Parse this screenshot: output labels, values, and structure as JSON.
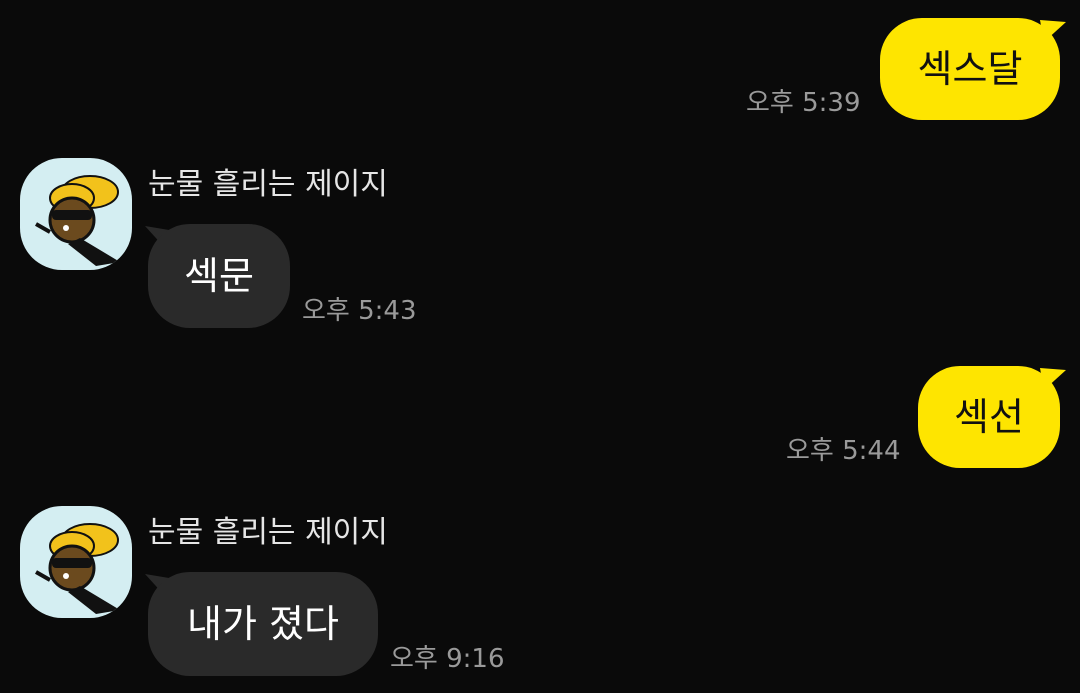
{
  "messages": [
    {
      "from": "me",
      "text": "섹스달",
      "time": "오후 5:39"
    },
    {
      "from": "other",
      "sender": "눈물 흘리는 제이지",
      "text": "섹문",
      "time": "오후 5:43"
    },
    {
      "from": "me",
      "text": "섹선",
      "time": "오후 5:44"
    },
    {
      "from": "other",
      "sender": "눈물 흘리는 제이지",
      "text": "내가 졌다",
      "time": "오후 9:16"
    }
  ],
  "colors": {
    "background": "#0a0a0a",
    "my_bubble": "#fee500",
    "other_bubble": "#2a2a2a",
    "timestamp": "#9a9a9a",
    "avatar_bg": "#d4eef2"
  },
  "avatar_icon": "crying-character-avatar"
}
